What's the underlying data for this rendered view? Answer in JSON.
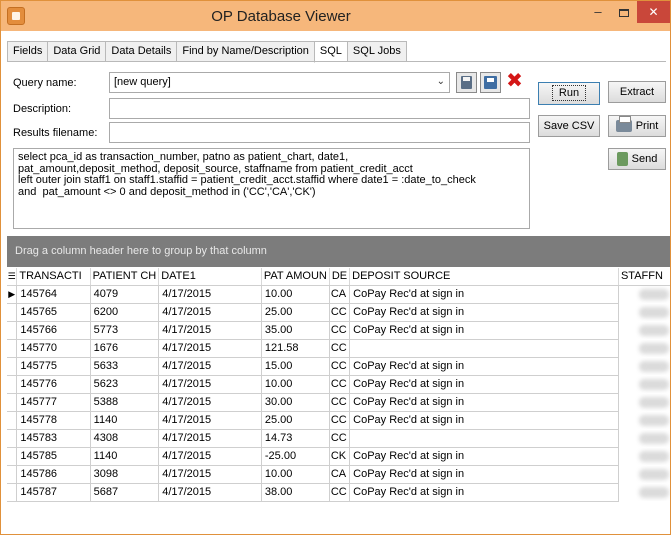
{
  "window": {
    "title": "OP Database Viewer",
    "minimize": "–",
    "close": "✕"
  },
  "tabs": [
    "Fields",
    "Data Grid",
    "Data Details",
    "Find by Name/Description",
    "SQL",
    "SQL Jobs"
  ],
  "active_tab": "SQL",
  "form": {
    "query_name_label": "Query name:",
    "query_name_value": "[new query]",
    "description_label": "Description:",
    "description_value": "",
    "results_filename_label": "Results filename:",
    "results_filename_value": ""
  },
  "buttons": {
    "run": "Run",
    "extract": "Extract",
    "save_csv": "Save CSV",
    "print": "Print",
    "send": "Send"
  },
  "sql_lines": [
    "select pca_id as transaction_number, patno as patient_chart, date1,",
    "pat_amount,deposit_method, deposit_source, staffname from patient_credit_acct",
    "left outer join staff1 on staff1.staffid = patient_credit_acct.staffid where date1 = :date_to_check",
    "and  pat_amount <> 0 and deposit_method in ('CC','CA','CK')"
  ],
  "group_by_hint": "Drag a column header here to group by that column",
  "grid": {
    "columns": [
      "TRANSACTI",
      "PATIENT CH",
      "DATE1",
      "PAT AMOUN",
      "DE",
      "DEPOSIT SOURCE",
      "STAFFN"
    ],
    "rows": [
      [
        "145764",
        "4079",
        "4/17/2015",
        "10.00",
        "CA",
        "CoPay Rec'd at sign in"
      ],
      [
        "145765",
        "6200",
        "4/17/2015",
        "25.00",
        "CC",
        "CoPay Rec'd at sign in"
      ],
      [
        "145766",
        "5773",
        "4/17/2015",
        "35.00",
        "CC",
        "CoPay Rec'd at sign in"
      ],
      [
        "145770",
        "1676",
        "4/17/2015",
        "121.58",
        "CC",
        ""
      ],
      [
        "145775",
        "5633",
        "4/17/2015",
        "15.00",
        "CC",
        "CoPay Rec'd at sign in"
      ],
      [
        "145776",
        "5623",
        "4/17/2015",
        "10.00",
        "CC",
        "CoPay Rec'd at sign in"
      ],
      [
        "145777",
        "5388",
        "4/17/2015",
        "30.00",
        "CC",
        "CoPay Rec'd at sign in"
      ],
      [
        "145778",
        "1140",
        "4/17/2015",
        "25.00",
        "CC",
        "CoPay Rec'd at sign in"
      ],
      [
        "145783",
        "4308",
        "4/17/2015",
        "14.73",
        "CC",
        ""
      ],
      [
        "145785",
        "1140",
        "4/17/2015",
        "-25.00",
        "CK",
        "CoPay Rec'd at sign in"
      ],
      [
        "145786",
        "3098",
        "4/17/2015",
        "10.00",
        "CA",
        "CoPay Rec'd at sign in"
      ],
      [
        "145787",
        "5687",
        "4/17/2015",
        "38.00",
        "CC",
        "CoPay Rec'd at sign in"
      ]
    ],
    "current_row_marker": "▶"
  },
  "icons": {
    "combo_arrow": "⌄",
    "delete": "✖",
    "grid_menu": "☰"
  },
  "colors": {
    "titlebar": "#f6b77b",
    "close_button": "#c9473a",
    "group_bar": "#7c7c7c"
  }
}
